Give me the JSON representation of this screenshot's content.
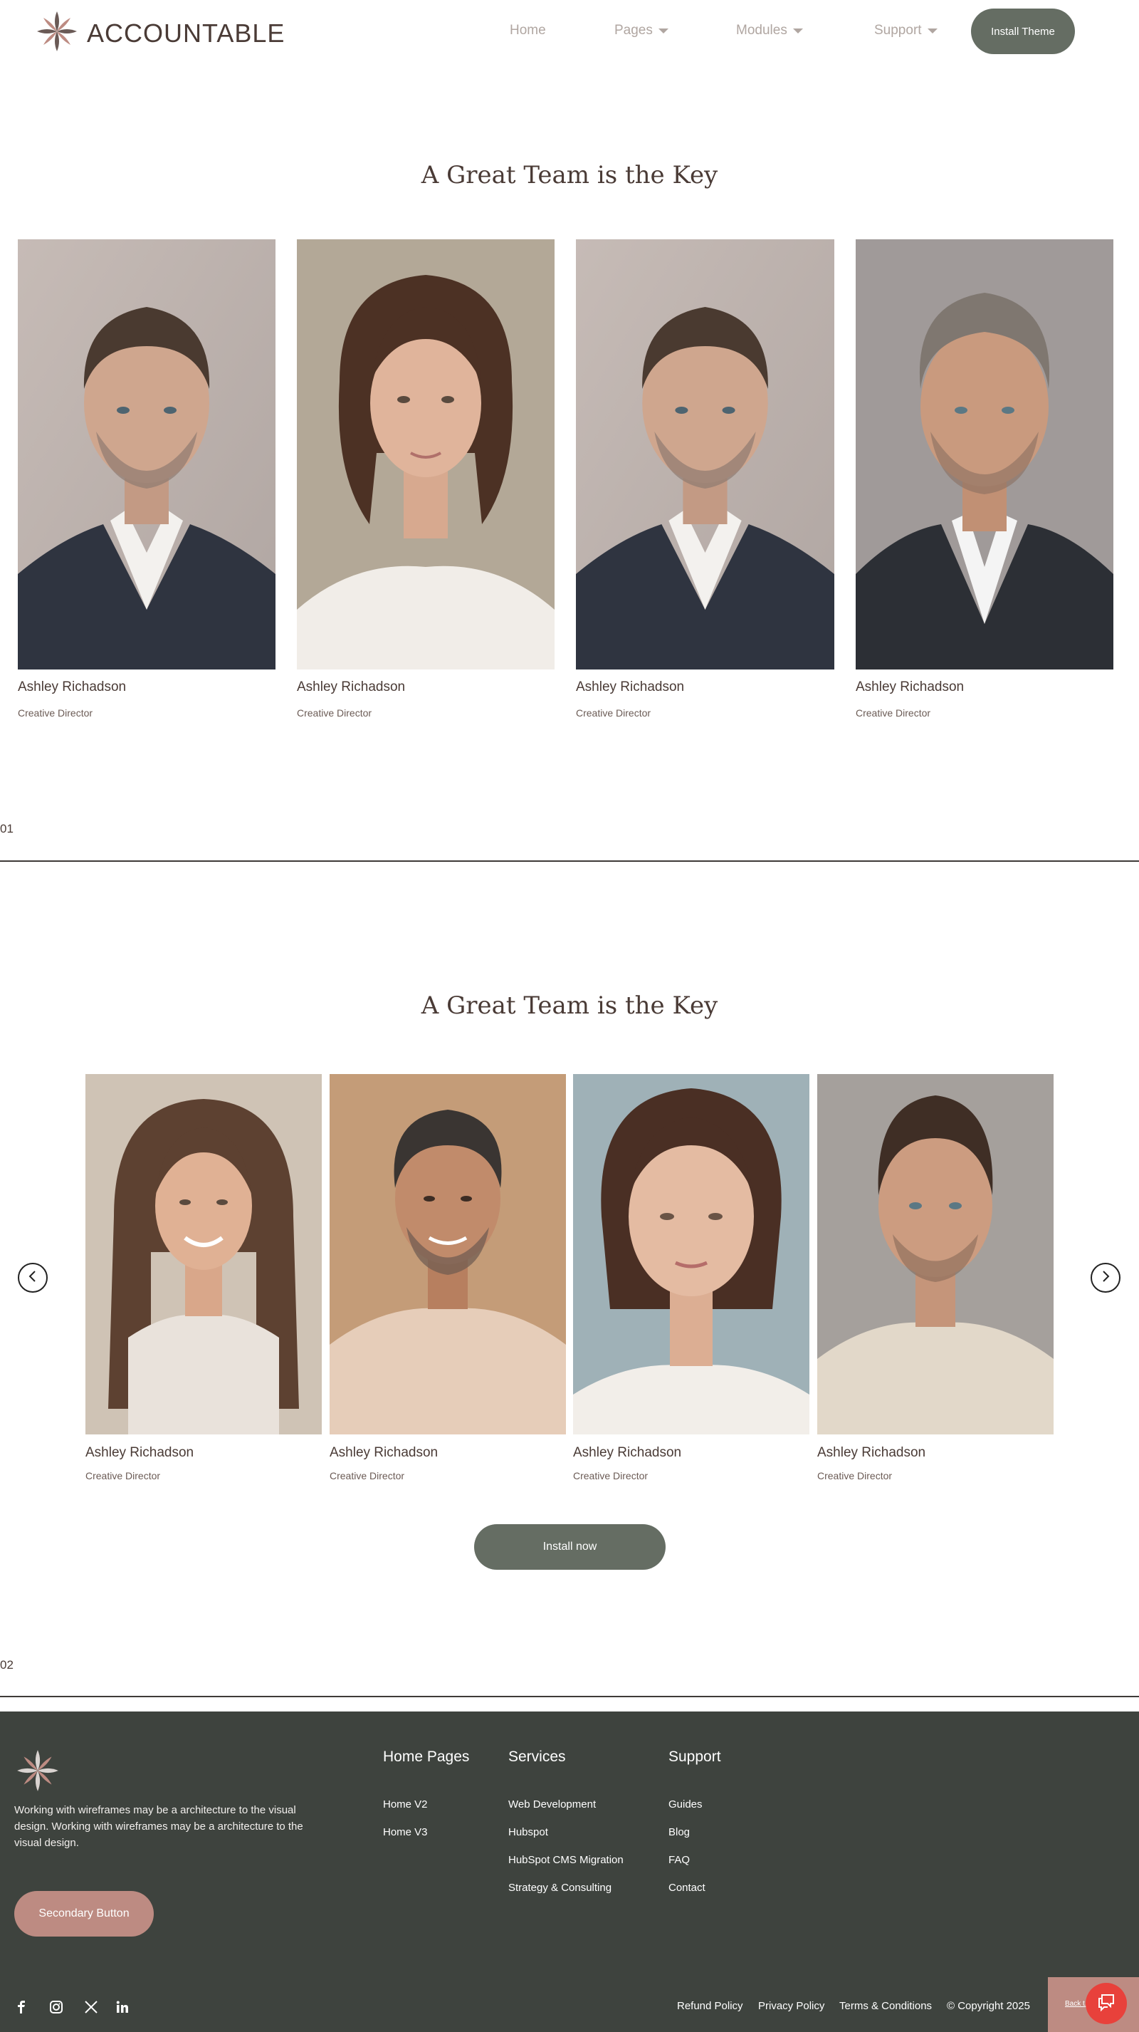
{
  "brand": {
    "name": "ACCOUNTABLE"
  },
  "nav": {
    "items": [
      {
        "label": "Home",
        "dropdown": false
      },
      {
        "label": "Pages",
        "dropdown": true
      },
      {
        "label": "Modules",
        "dropdown": true
      },
      {
        "label": "Support",
        "dropdown": true
      }
    ],
    "cta_label": "Install Theme"
  },
  "section1": {
    "title": "A Great Team is the Key",
    "number": "01",
    "members": [
      {
        "name": "Ashley Richadson",
        "role": "Creative Director",
        "photo": "man-suit-portrait"
      },
      {
        "name": "Ashley Richadson",
        "role": "Creative Director",
        "photo": "woman-white-top-portrait"
      },
      {
        "name": "Ashley Richadson",
        "role": "Creative Director",
        "photo": "man-suit-portrait"
      },
      {
        "name": "Ashley Richadson",
        "role": "Creative Director",
        "photo": "man-grey-hair-portrait"
      }
    ]
  },
  "section2": {
    "title": "A Great Team is the Key",
    "number": "02",
    "members": [
      {
        "name": "Ashley Richadson",
        "role": "Creative Director",
        "photo": "woman-long-hair-portrait"
      },
      {
        "name": "Ashley Richadson",
        "role": "Creative Director",
        "photo": "man-tshirt-portrait"
      },
      {
        "name": "Ashley Richadson",
        "role": "Creative Director",
        "photo": "woman-blue-bg-portrait"
      },
      {
        "name": "Ashley Richadson",
        "role": "Creative Director",
        "photo": "man-henley-portrait"
      }
    ],
    "prev_icon": "chevron-left-icon",
    "next_icon": "chevron-right-icon",
    "cta_label": "Install now"
  },
  "footer": {
    "description": "Working with wireframes may be a architecture to the visual design. Working with wireframes may be a architecture to the visual design.",
    "secondary_button": "Secondary Button",
    "columns": [
      {
        "title": "Home Pages",
        "links": [
          "Home V2",
          "Home V3"
        ]
      },
      {
        "title": "Services",
        "links": [
          "Web Development",
          "Hubspot",
          "HubSpot CMS Migration",
          "Strategy & Consulting"
        ]
      },
      {
        "title": "Support",
        "links": [
          "Guides",
          "Blog",
          "FAQ",
          "Contact"
        ]
      }
    ],
    "social": [
      "facebook-icon",
      "instagram-icon",
      "x-icon",
      "linkedin-icon"
    ],
    "legal": {
      "refund": "Refund Policy",
      "privacy": "Privacy Policy",
      "terms": "Terms & Conditions",
      "copyright": "© Copyright 2025"
    },
    "back_to_top": "Back t..."
  },
  "colors": {
    "text": "#4a3b36",
    "button_green": "#656d63",
    "button_rose": "#bd8b82",
    "footer_bg": "#3e433e",
    "chat_red": "#e8413b"
  }
}
